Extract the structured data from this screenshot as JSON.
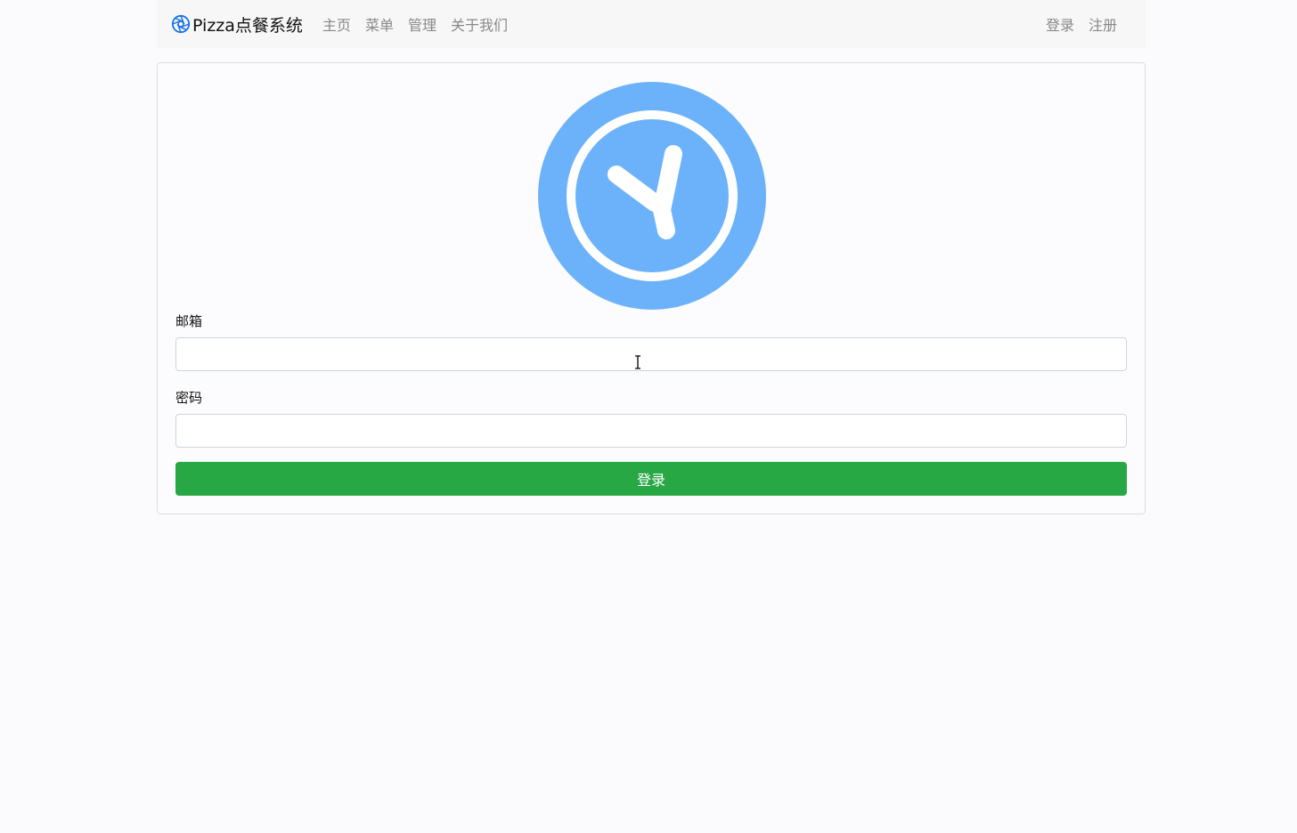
{
  "app": {
    "brand_name": "Pizza点餐系统",
    "brand_icon": "aperture-icon",
    "brand_icon_color": "#1a73e8"
  },
  "nav": {
    "left_items": [
      "主页",
      "菜单",
      "管理",
      "关于我们"
    ],
    "right_items": [
      "登录",
      "注册"
    ],
    "link_color": "#888888"
  },
  "login_form": {
    "logo_icon": "clock-logo-icon",
    "logo_color": "#6cb2fb",
    "email_label": "邮箱",
    "email_value": "",
    "email_placeholder": "",
    "password_label": "密码",
    "password_value": "",
    "password_placeholder": "",
    "submit_label": "登录",
    "submit_color": "#28a745"
  }
}
